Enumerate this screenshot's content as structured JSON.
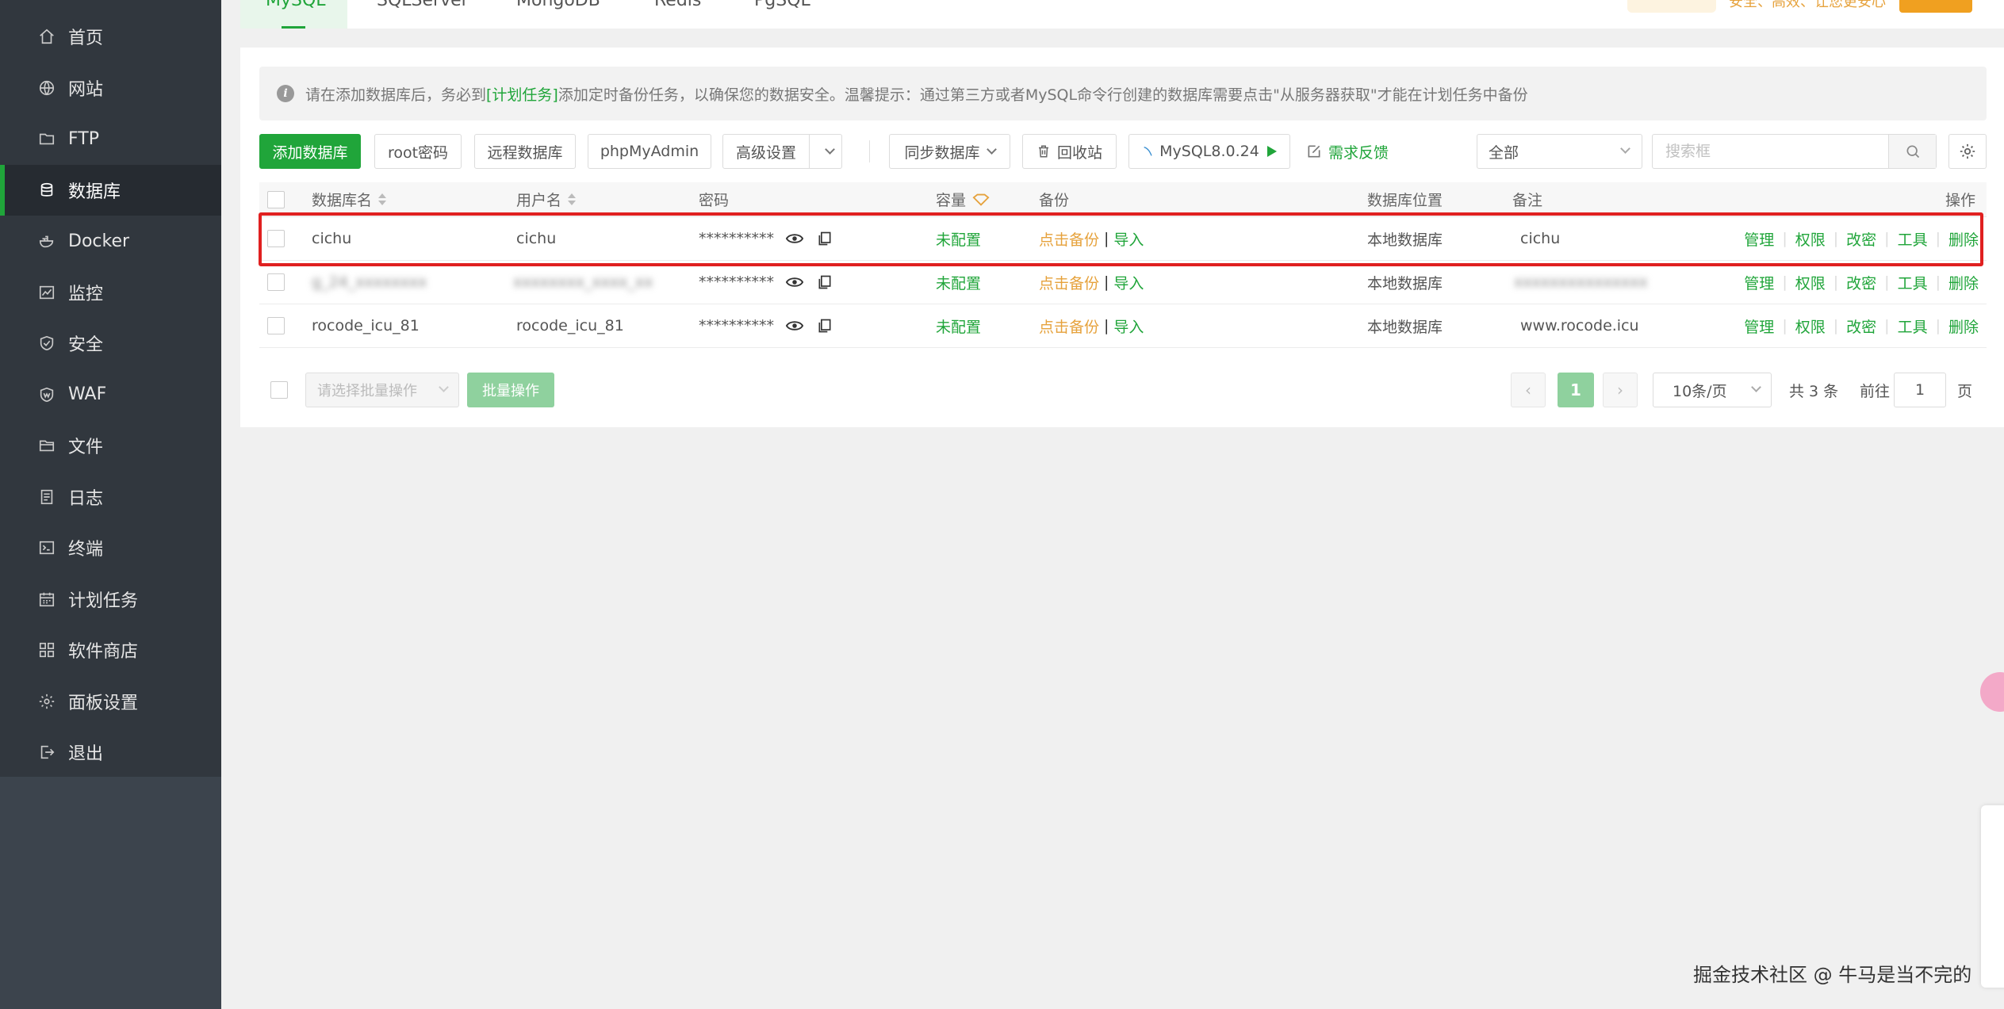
{
  "sidebar": {
    "items": [
      {
        "label": "首页",
        "icon": "home-icon"
      },
      {
        "label": "网站",
        "icon": "globe-icon"
      },
      {
        "label": "FTP",
        "icon": "folder-icon"
      },
      {
        "label": "数据库",
        "icon": "database-icon",
        "active": true
      },
      {
        "label": "Docker",
        "icon": "docker-icon"
      },
      {
        "label": "监控",
        "icon": "monitor-icon"
      },
      {
        "label": "安全",
        "icon": "shield-icon"
      },
      {
        "label": "WAF",
        "icon": "waf-shield-icon"
      },
      {
        "label": "文件",
        "icon": "files-icon"
      },
      {
        "label": "日志",
        "icon": "log-icon"
      },
      {
        "label": "终端",
        "icon": "terminal-icon"
      },
      {
        "label": "计划任务",
        "icon": "calendar-icon"
      },
      {
        "label": "软件商店",
        "icon": "apps-icon"
      },
      {
        "label": "面板设置",
        "icon": "gear-icon"
      },
      {
        "label": "退出",
        "icon": "logout-icon"
      }
    ]
  },
  "tabs": [
    "MySQL",
    "SQLServer",
    "MongoDB",
    "Redis",
    "PgSQL"
  ],
  "promo": {
    "text": "安全、高效、让您更安心"
  },
  "notice": {
    "prefix": "请在添加数据库后，务必到",
    "link": "[计划任务]",
    "suffix": "添加定时备份任务，以确保您的数据安全。温馨提示：通过第三方或者MySQL命令行创建的数据库需要点击\"从服务器获取\"才能在计划任务中备份"
  },
  "toolbar": {
    "add_db": "添加数据库",
    "root_pwd": "root密码",
    "remote_db": "远程数据库",
    "phpmyadmin": "phpMyAdmin",
    "advanced": "高级设置",
    "sync_db": "同步数据库",
    "recycle": "回收站",
    "mysql_version": "MySQL8.0.24",
    "feedback": "需求反馈",
    "filter_value": "全部",
    "search_placeholder": "搜索框"
  },
  "table": {
    "headers": {
      "name": "数据库名",
      "user": "用户名",
      "password": "密码",
      "capacity": "容量",
      "backup": "备份",
      "location": "数据库位置",
      "note": "备注",
      "actions": "操作"
    },
    "rows": [
      {
        "name": "cichu",
        "user": "cichu",
        "password": "**********",
        "capacity": "未配置",
        "backup": "点击备份",
        "import": "导入",
        "location": "本地数据库",
        "note": "cichu"
      },
      {
        "name": "g_24_xxxxxxxx",
        "user": "xxxxxxxx_xxxx_xx",
        "password": "**********",
        "capacity": "未配置",
        "backup": "点击备份",
        "import": "导入",
        "location": "本地数据库",
        "note": "xxxxxxxxxxxxxxx"
      },
      {
        "name": "rocode_icu_81",
        "user": "rocode_icu_81",
        "password": "**********",
        "capacity": "未配置",
        "backup": "点击备份",
        "import": "导入",
        "location": "本地数据库",
        "note": "www.rocode.icu"
      }
    ],
    "ops": [
      "管理",
      "权限",
      "改密",
      "工具",
      "删除"
    ]
  },
  "footer": {
    "batch_placeholder": "请选择批量操作",
    "batch_btn": "批量操作",
    "current_page": "1",
    "per_page": "10条/页",
    "total": "共 3 条",
    "goto": "前往",
    "goto_value": "1",
    "page_unit": "页"
  },
  "watermark": "掘金技术社区 @ 牛马是当不完的",
  "colors": {
    "accent": "#20a53a",
    "sidebar": "#31373e",
    "warn": "#e6a23c",
    "highlight": "#e02020"
  }
}
